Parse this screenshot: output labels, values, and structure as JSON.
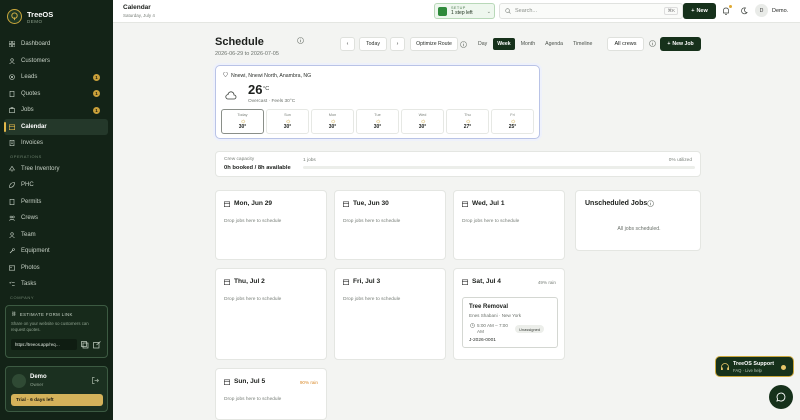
{
  "brand": {
    "title": "TreeOS",
    "sub": "DEMO"
  },
  "sidebar": {
    "items": [
      {
        "label": "Dashboard",
        "icon": "grid-icon"
      },
      {
        "label": "Customers",
        "icon": "users-icon"
      },
      {
        "label": "Leads",
        "icon": "target-icon",
        "badge": "1"
      },
      {
        "label": "Quotes",
        "icon": "file-icon",
        "badge": "1"
      },
      {
        "label": "Jobs",
        "icon": "briefcase-icon",
        "badge": "1"
      },
      {
        "label": "Calendar",
        "icon": "calendar-icon",
        "active": true
      },
      {
        "label": "Invoices",
        "icon": "receipt-icon"
      }
    ],
    "section_label": "OPERATIONS",
    "ops_items": [
      {
        "label": "Tree Inventory",
        "icon": "tree-icon"
      },
      {
        "label": "PHC",
        "icon": "leaf-icon"
      },
      {
        "label": "Permits",
        "icon": "document-icon"
      },
      {
        "label": "Crews",
        "icon": "crew-icon"
      },
      {
        "label": "Team",
        "icon": "team-icon"
      },
      {
        "label": "Equipment",
        "icon": "wrench-icon"
      },
      {
        "label": "Photos",
        "icon": "image-icon"
      },
      {
        "label": "Tasks",
        "icon": "checklist-icon"
      }
    ],
    "section2_label": "COMPANY",
    "form_card": {
      "title": "ESTIMATE FORM LINK",
      "desc": "Share on your website so customers can request quotes.",
      "url": "https://treeos.app/req…"
    },
    "user": {
      "name": "Demo",
      "role": "Owner",
      "trial": "Trial · 6 days left"
    }
  },
  "topbar": {
    "title": "Calendar",
    "date": "Saturday, July 4",
    "setup_label": "SETUP",
    "setup_status": "1 step left",
    "search_placeholder": "Search...",
    "search_kbd": "⌘K",
    "new_label": "New",
    "account_initial": "D",
    "account_name": "Demo."
  },
  "schedule": {
    "title": "Schedule",
    "range": "2026-06-29 to 2026-07-05",
    "today": "Today",
    "optimize": "Optimize Route",
    "views": [
      "Day",
      "Week",
      "Month",
      "Agenda",
      "Timeline"
    ],
    "selected_view": "Week",
    "crews": "All crews",
    "new_job": "New Job"
  },
  "weather": {
    "location": "Nnewi, Nnewi North, Anambra, NG",
    "temp": "26",
    "unit": "°C",
    "desc": "Overcast · Feels 30°C",
    "days": [
      {
        "name": "Today",
        "temp": "30°"
      },
      {
        "name": "Sun",
        "temp": "30°"
      },
      {
        "name": "Mon",
        "temp": "30°"
      },
      {
        "name": "Tue",
        "temp": "30°"
      },
      {
        "name": "Wed",
        "temp": "30°"
      },
      {
        "name": "Thu",
        "temp": "27°"
      },
      {
        "name": "Fri",
        "temp": "25°"
      }
    ]
  },
  "capacity": {
    "label": "Crew capacity",
    "value": "0h booked / 8h available",
    "jobs": "1 jobs",
    "utilized": "0% utilized",
    "fill_pct": 0
  },
  "days": [
    {
      "title": "Mon, Jun 29",
      "empty": "Drop jobs here to schedule"
    },
    {
      "title": "Tue, Jun 30",
      "empty": "Drop jobs here to schedule"
    },
    {
      "title": "Wed, Jul 1",
      "empty": "Drop jobs here to schedule"
    },
    {
      "title": "Thu, Jul 2",
      "empty": "Drop jobs here to schedule"
    },
    {
      "title": "Fri, Jul 3",
      "empty": "Drop jobs here to schedule"
    },
    {
      "title": "Sat, Jul 4",
      "rain": "49% rain"
    },
    {
      "title": "Sun, Jul 5",
      "empty": "Drop jobs here to schedule",
      "rain": "90% rain"
    }
  ],
  "job": {
    "title": "Tree Removal",
    "customer": "Enes Shabani · New York",
    "time": "5:00 AM – 7:00 AM",
    "badge": "Unassigned",
    "id": "J-2026-0001"
  },
  "unscheduled": {
    "title": "Unscheduled Jobs",
    "message": "All jobs scheduled."
  },
  "support": {
    "title": "TreeOS Support",
    "sub": "FAQ · Live help"
  }
}
